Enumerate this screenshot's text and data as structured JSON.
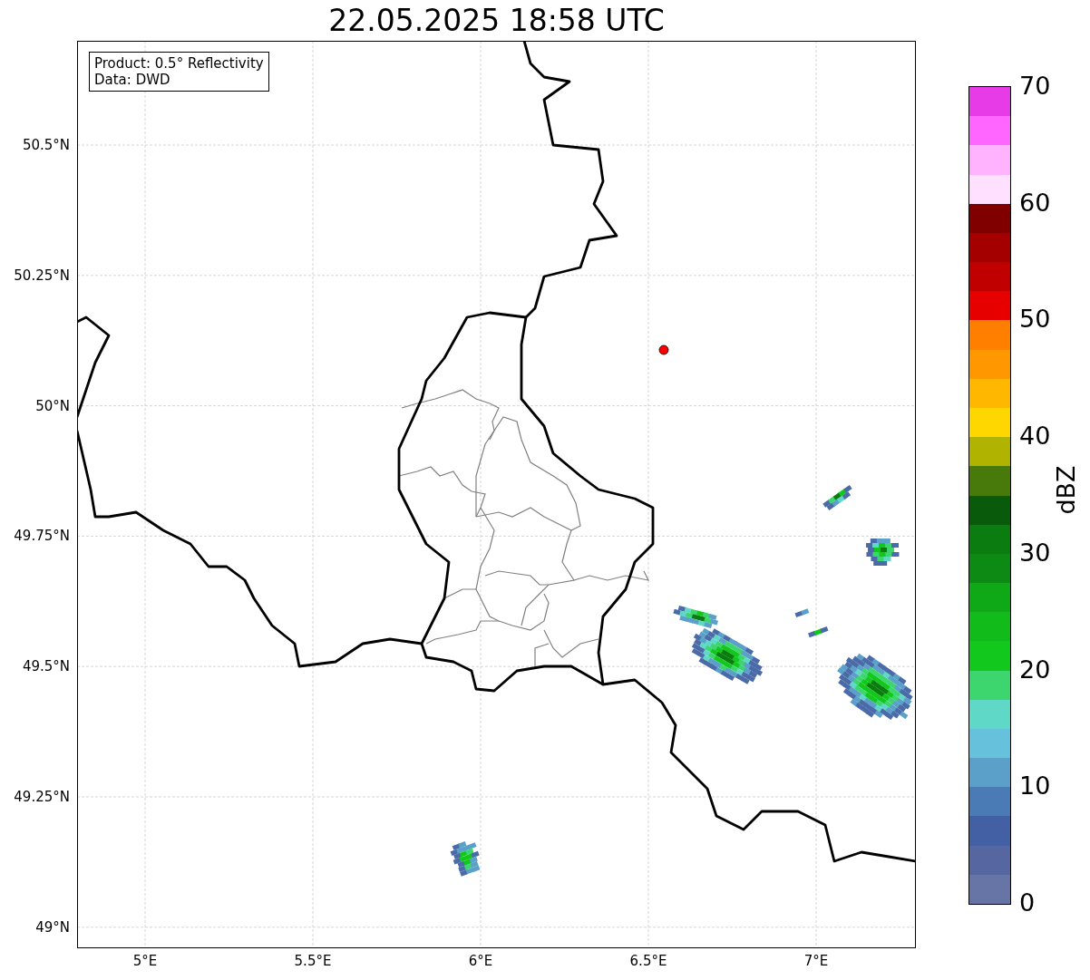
{
  "title": "22.05.2025 18:58 UTC",
  "map": {
    "legend": [
      "Product: 0.5° Reflectivity",
      "Data: DWD"
    ],
    "lat_ticks": [
      "50.5°N",
      "50.25°N",
      "50°N",
      "49.75°N",
      "49.5°N",
      "49.25°N",
      "49°N"
    ],
    "lon_ticks": [
      "5°E",
      "5.5°E",
      "6°E",
      "6.5°E",
      "7°E"
    ]
  },
  "colorbar": {
    "label": "dBZ",
    "ticks": [
      "70",
      "60",
      "50",
      "40",
      "30",
      "20",
      "10",
      "0"
    ],
    "bins": [
      {
        "color": "#e83be8"
      },
      {
        "color": "#ff66ff"
      },
      {
        "color": "#ffb3ff"
      },
      {
        "color": "#ffe0ff"
      },
      {
        "color": "#800000"
      },
      {
        "color": "#a50000"
      },
      {
        "color": "#c00000"
      },
      {
        "color": "#e60000"
      },
      {
        "color": "#ff7f00"
      },
      {
        "color": "#ff9800"
      },
      {
        "color": "#ffb700"
      },
      {
        "color": "#ffd700"
      },
      {
        "color": "#b0b300"
      },
      {
        "color": "#477a0a"
      },
      {
        "color": "#0a5a0c"
      },
      {
        "color": "#0b7d10"
      },
      {
        "color": "#0d8a14"
      },
      {
        "color": "#0fa816"
      },
      {
        "color": "#11bb1a"
      },
      {
        "color": "#12c81c"
      },
      {
        "color": "#3dd66e"
      },
      {
        "color": "#5fd8c8"
      },
      {
        "color": "#66c2dc"
      },
      {
        "color": "#5ba0c8"
      },
      {
        "color": "#4a7bb5"
      },
      {
        "color": "#4460a5"
      },
      {
        "color": "#5566a0"
      },
      {
        "color": "#6675a6"
      }
    ]
  }
}
